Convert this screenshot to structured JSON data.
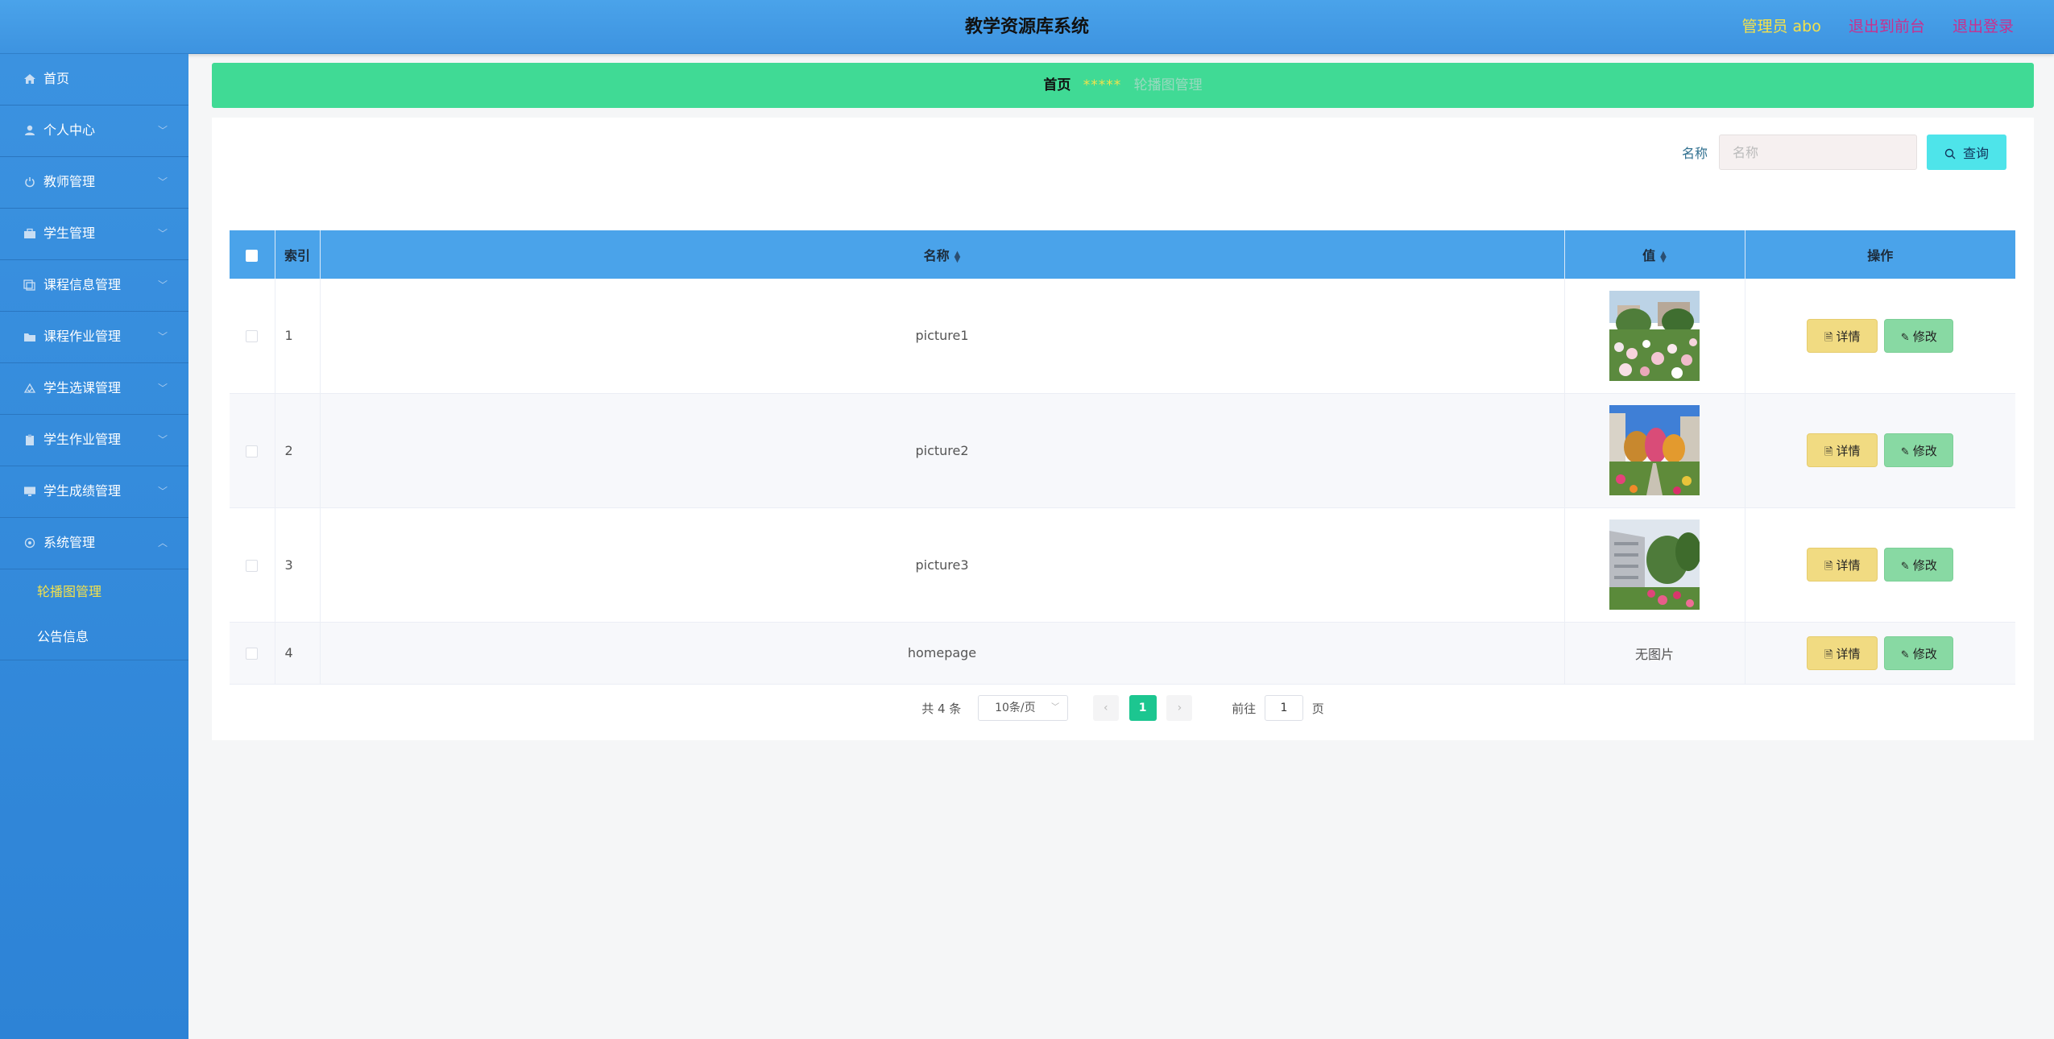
{
  "header": {
    "title": "教学资源库系统",
    "admin": "管理员 abo",
    "to_front": "退出到前台",
    "logout": "退出登录"
  },
  "sidebar": {
    "items": [
      {
        "label": "首页",
        "icon": "home-icon"
      },
      {
        "label": "个人中心",
        "icon": "user-icon"
      },
      {
        "label": "教师管理",
        "icon": "power-icon"
      },
      {
        "label": "学生管理",
        "icon": "briefcase-icon"
      },
      {
        "label": "课程信息管理",
        "icon": "copy-icon"
      },
      {
        "label": "课程作业管理",
        "icon": "folder-icon"
      },
      {
        "label": "学生选课管理",
        "icon": "check-icon"
      },
      {
        "label": "学生作业管理",
        "icon": "clipboard-icon"
      },
      {
        "label": "学生成绩管理",
        "icon": "monitor-icon"
      },
      {
        "label": "系统管理",
        "icon": "setting-icon"
      }
    ],
    "sub_items": [
      {
        "label": "轮播图管理",
        "active": true
      },
      {
        "label": "公告信息",
        "active": false
      }
    ]
  },
  "breadcrumb": {
    "home": "首页",
    "separator": "*****",
    "current": "轮播图管理"
  },
  "search": {
    "label": "名称",
    "placeholder": "名称",
    "value": "",
    "button": "查询"
  },
  "table": {
    "headers": {
      "index": "索引",
      "name": "名称",
      "value": "值",
      "ops": "操作"
    },
    "rows": [
      {
        "index": "1",
        "name": "picture1",
        "image": "campus-flowers-photo"
      },
      {
        "index": "2",
        "name": "picture2",
        "image": "campus-garden-photo"
      },
      {
        "index": "3",
        "name": "picture3",
        "image": "campus-building-photo"
      },
      {
        "index": "4",
        "name": "homepage",
        "image": null,
        "no_image": "无图片"
      }
    ],
    "detail_button": "详情",
    "edit_button": "修改"
  },
  "pagination": {
    "total": "共 4 条",
    "page_size": "10条/页",
    "current_page": "1",
    "goto_label": "前往",
    "goto_value": "1",
    "page_unit": "页"
  },
  "colors": {
    "header": "#4aa3ea",
    "sidebar": "#3b92e0",
    "breadcrumb": "#40da95",
    "accent": "#1cc690",
    "detail_btn": "#f1db82",
    "edit_btn": "#88d9a3",
    "search_btn": "#4ee4ea"
  }
}
